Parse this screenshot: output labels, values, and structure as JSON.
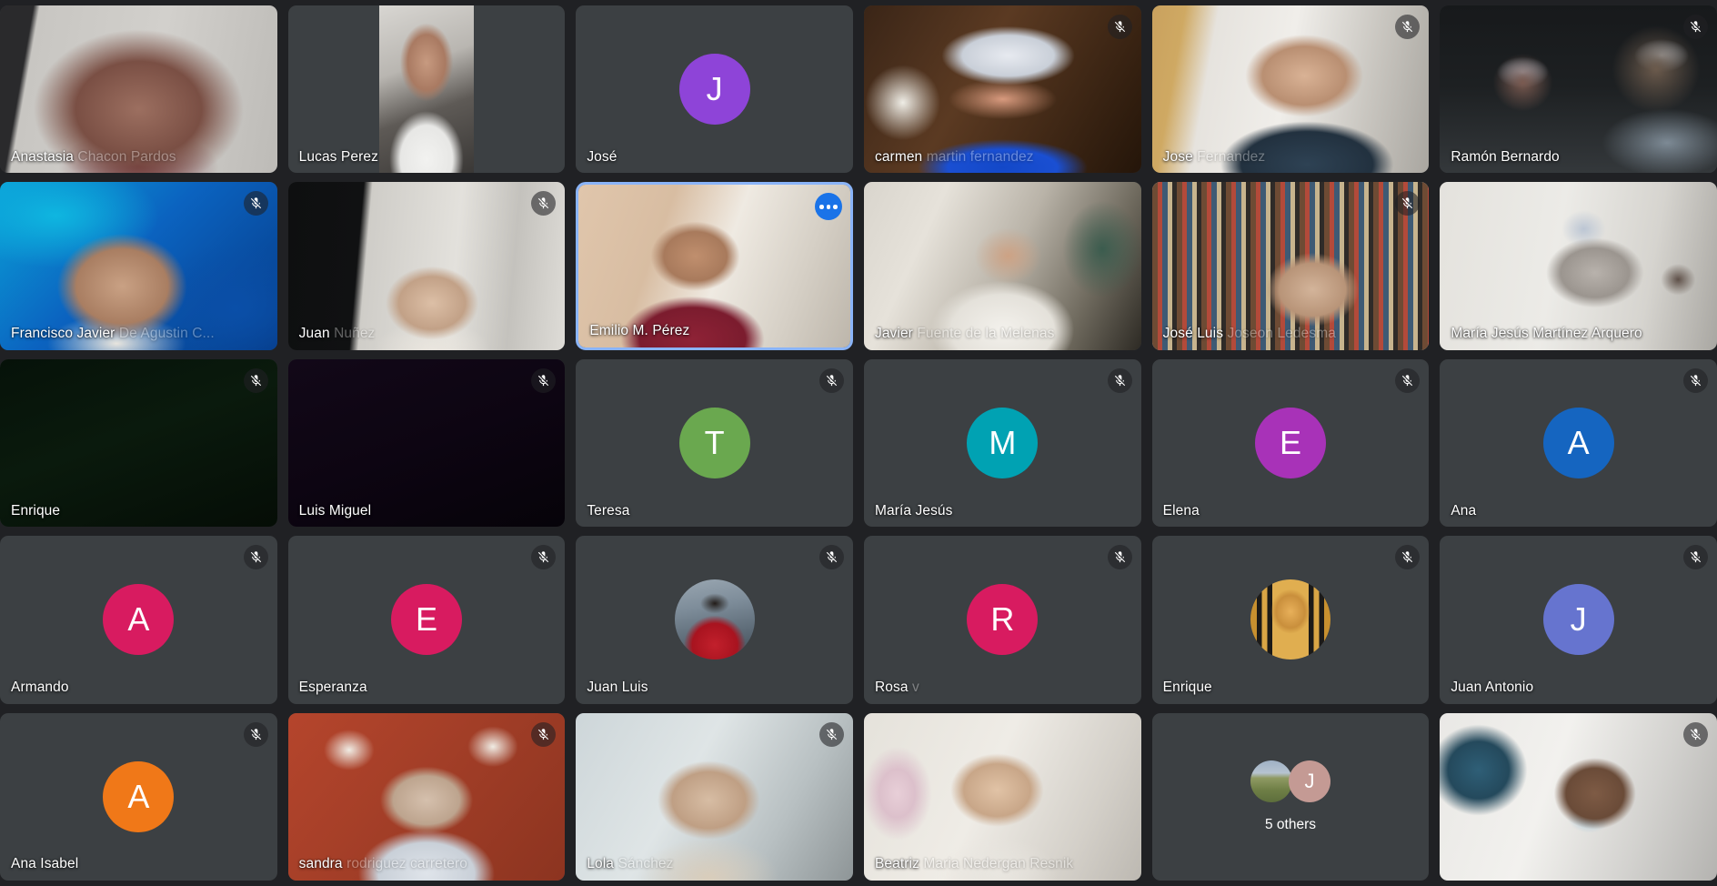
{
  "app": {
    "name": "video-conference-grid",
    "background_color": "#202124",
    "tile_color": "#3c4043",
    "active_border_color": "#8ab4f8",
    "more_button_color": "#1a73e8"
  },
  "grid": {
    "columns": 6,
    "rows": 5,
    "total_tiles": 30
  },
  "overflow": {
    "label": "5 others",
    "count": 5,
    "avatar_initial": "J",
    "avatar_color": "#c49a94"
  },
  "participants": [
    {
      "id": 1,
      "name": "Anastasia",
      "name_faded": "Chacon Pardos",
      "muted": false,
      "kind": "video",
      "scene": "sc-anastasia",
      "active": false
    },
    {
      "id": 2,
      "name": "Lucas Perez",
      "name_faded": "",
      "muted": false,
      "kind": "video",
      "scene": "sc-lucas",
      "pillarbox": true,
      "active": false
    },
    {
      "id": 3,
      "name": "José",
      "name_faded": "",
      "muted": false,
      "kind": "avatar",
      "initial": "J",
      "avatar_color": "#8e44d8",
      "active": false
    },
    {
      "id": 4,
      "name": "carmen",
      "name_faded": "martin fernandez",
      "muted": true,
      "kind": "video",
      "scene": "sc-carmen",
      "active": false
    },
    {
      "id": 5,
      "name": "Jose",
      "name_faded": "Fernandez",
      "muted": true,
      "kind": "video",
      "scene": "sc-jose1",
      "active": false
    },
    {
      "id": 6,
      "name": "Ramón Bernardo",
      "name_faded": "",
      "muted": true,
      "kind": "video",
      "scene": "sc-ramon",
      "active": false
    },
    {
      "id": 7,
      "name": "Francisco Javier",
      "name_faded": "De Agustin C...",
      "muted": true,
      "kind": "video",
      "scene": "sc-fjavier",
      "active": false
    },
    {
      "id": 8,
      "name": "Juan",
      "name_faded": "Nuñez",
      "muted": true,
      "kind": "video",
      "scene": "sc-juan",
      "active": false
    },
    {
      "id": 9,
      "name": "Emilio M. Pérez",
      "name_faded": "",
      "muted": false,
      "kind": "video",
      "scene": "sc-emilio",
      "active": true,
      "has_more_button": true
    },
    {
      "id": 10,
      "name": "Javier",
      "name_faded": "Fuente de la Melenas",
      "muted": false,
      "kind": "video",
      "scene": "sc-javier",
      "active": false
    },
    {
      "id": 11,
      "name": "José Luis",
      "name_faded": "Joseon Ledesma",
      "muted": true,
      "kind": "video",
      "scene": "sc-joseluis",
      "active": false
    },
    {
      "id": 12,
      "name": "María Jesús Martínez Arquero",
      "name_faded": "",
      "muted": false,
      "kind": "video",
      "scene": "sc-mjesus",
      "active": false
    },
    {
      "id": 13,
      "name": "Enrique",
      "name_faded": "",
      "muted": true,
      "kind": "dark",
      "scene": "sc-enrique-dark",
      "active": false
    },
    {
      "id": 14,
      "name": "Luis Miguel",
      "name_faded": "",
      "muted": true,
      "kind": "dark",
      "scene": "sc-luismiguel-dark",
      "active": false
    },
    {
      "id": 15,
      "name": "Teresa",
      "name_faded": "",
      "muted": true,
      "kind": "avatar",
      "initial": "T",
      "avatar_color": "#6aa84f",
      "active": false
    },
    {
      "id": 16,
      "name": "María Jesús",
      "name_faded": "",
      "muted": true,
      "kind": "avatar",
      "initial": "M",
      "avatar_color": "#00a2b3",
      "active": false
    },
    {
      "id": 17,
      "name": "Elena",
      "name_faded": "",
      "muted": true,
      "kind": "avatar",
      "initial": "E",
      "avatar_color": "#a832b8",
      "active": false
    },
    {
      "id": 18,
      "name": "Ana",
      "name_faded": "",
      "muted": true,
      "kind": "avatar",
      "initial": "A",
      "avatar_color": "#1565c0",
      "active": false
    },
    {
      "id": 19,
      "name": "Armando",
      "name_faded": "",
      "muted": true,
      "kind": "avatar",
      "initial": "A",
      "avatar_color": "#d81b60",
      "active": false
    },
    {
      "id": 20,
      "name": "Esperanza",
      "name_faded": "",
      "muted": true,
      "kind": "avatar",
      "initial": "E",
      "avatar_color": "#d81b60",
      "active": false
    },
    {
      "id": 21,
      "name": "Juan Luis",
      "name_faded": "",
      "muted": true,
      "kind": "photo",
      "photo": "photo-juanluis",
      "active": false
    },
    {
      "id": 22,
      "name": "Rosa",
      "name_faded": "v",
      "muted": true,
      "kind": "avatar",
      "initial": "R",
      "avatar_color": "#d81b60",
      "active": false
    },
    {
      "id": 23,
      "name": "Enrique",
      "name_faded": "",
      "muted": true,
      "kind": "photo",
      "photo": "pharaoh",
      "active": false
    },
    {
      "id": 24,
      "name": "Juan Antonio",
      "name_faded": "",
      "muted": true,
      "kind": "avatar",
      "initial": "J",
      "avatar_color": "#6674cf",
      "active": false
    },
    {
      "id": 25,
      "name": "Ana Isabel",
      "name_faded": "",
      "muted": true,
      "kind": "avatar",
      "initial": "A",
      "avatar_color": "#f07818",
      "active": false
    },
    {
      "id": 26,
      "name": "sandra",
      "name_faded": "rodriguez carretero",
      "muted": true,
      "kind": "video",
      "scene": "sc-sandra",
      "active": false
    },
    {
      "id": 27,
      "name": "Lola",
      "name_faded": "Sánchez",
      "muted": true,
      "kind": "video",
      "scene": "sc-lola",
      "active": false
    },
    {
      "id": 28,
      "name": "Beatriz",
      "name_faded": "Maria Nedergan Resnik",
      "muted": false,
      "kind": "video",
      "scene": "sc-beatriz",
      "active": false
    },
    {
      "id": 29,
      "name": "",
      "name_faded": "",
      "muted": false,
      "kind": "others",
      "active": false
    },
    {
      "id": 30,
      "name": "",
      "name_faded": "",
      "muted": true,
      "kind": "video",
      "scene": "sc-woman-mask",
      "active": false
    }
  ]
}
